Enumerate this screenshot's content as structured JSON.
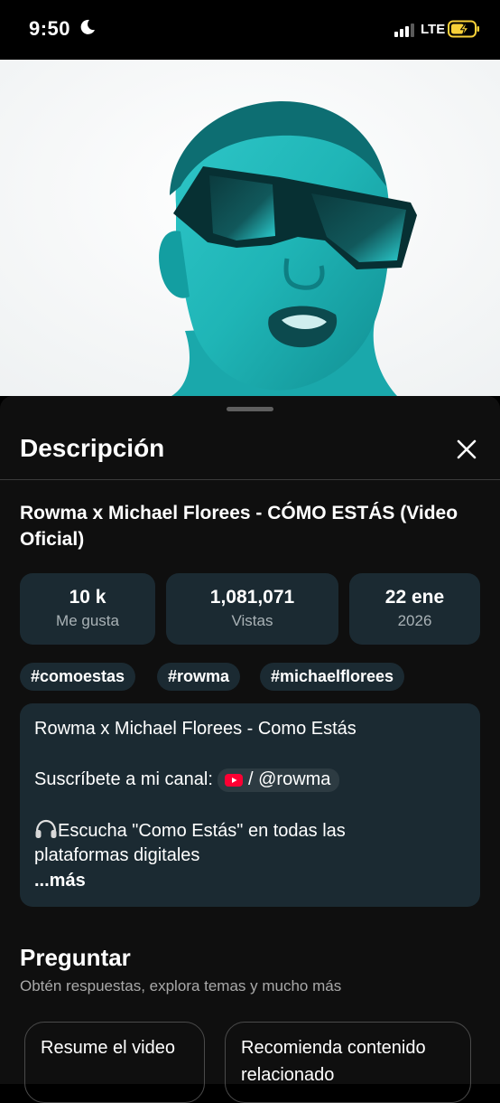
{
  "status_bar": {
    "time": "9:50",
    "network": "LTE"
  },
  "sheet": {
    "title": "Descripción",
    "video_title": "Rowma x Michael Florees - CÓMO ESTÁS (Video Oficial)",
    "stats": [
      {
        "value": "10 k",
        "label": "Me gusta"
      },
      {
        "value": "1,081,071",
        "label": "Vistas"
      },
      {
        "value": "22 ene",
        "label": "2026"
      }
    ],
    "hashtags": [
      "#comoestas",
      "#rowma",
      "#michaelflorees"
    ],
    "description": {
      "line1": "Rowma x Michael Florees - Como Estás",
      "subscribe_text": "Suscríbete a mi canal:",
      "channel_link": "/ @rowma",
      "listen_line1": "Escucha \"Como Estás\" en todas las",
      "listen_line2": "plataformas digitales",
      "more": "...más"
    },
    "ask": {
      "title": "Preguntar",
      "subtitle": "Obtén respuestas, explora temas y mucho más",
      "suggestions": [
        "Resume el video",
        "Recomienda contenido relacionado"
      ]
    }
  },
  "colors": {
    "card_bg": "#1b2a32",
    "sheet_bg": "#0f0f0f",
    "battery_charging": "#f7d039"
  }
}
